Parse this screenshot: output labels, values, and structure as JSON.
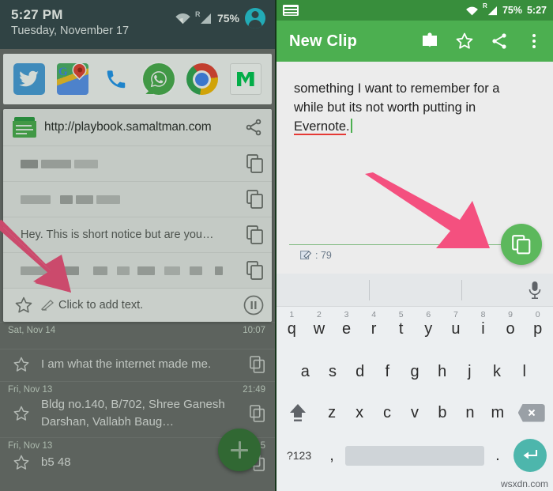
{
  "left": {
    "status_bar": {
      "time": "5:27 PM",
      "date": "Tuesday, November 17",
      "battery": "75%",
      "wifi_icon": "wifi-icon",
      "signal_icon": "roaming-signal-icon",
      "avatar_icon": "user-avatar-icon"
    },
    "shortcuts": [
      {
        "name": "twitter",
        "glyph": "🐦"
      },
      {
        "name": "google-maps",
        "glyph": ""
      },
      {
        "name": "phone",
        "glyph": "✆"
      },
      {
        "name": "whatsapp",
        "glyph": "✆"
      },
      {
        "name": "chrome",
        "glyph": ""
      },
      {
        "name": "medium",
        "glyph": ""
      }
    ],
    "notification": {
      "app_icon": "clipboard-notes-icon",
      "url": "http://playbook.samaltman.com",
      "share_icon": "share-icon",
      "clips": [
        {
          "text": "",
          "redacted": true,
          "redact_widths": [
            22,
            38,
            30
          ]
        },
        {
          "text": "",
          "redacted": true,
          "redact_widths": [
            38,
            16,
            22,
            30,
            18
          ]
        },
        {
          "text": "Hey. This is short notice but are you…",
          "redacted": false
        },
        {
          "text": "",
          "redacted": true,
          "redact_widths": [
            40,
            30,
            18,
            16,
            22,
            20,
            16,
            14,
            10
          ]
        }
      ],
      "footer": {
        "star_icon": "star-outline-icon",
        "edit_icon": "edit-pencil-icon",
        "hint": "Click to add text.",
        "pause_icon": "pause-circle-icon"
      }
    },
    "background_list": [
      {
        "date": "Sat, Nov 14",
        "time": "10:07",
        "text": "",
        "clipped": true
      },
      {
        "date": "",
        "time": "",
        "text": "I am what the internet made me."
      },
      {
        "date": "Fri, Nov 13",
        "time": "21:49",
        "text": "Bldg no.140, B/702, Shree Ganesh Darshan, Vallabh Baug…"
      },
      {
        "date": "Fri, Nov 13",
        "time": "15",
        "text": "b5 48"
      }
    ],
    "fab": {
      "icon": "plus-icon",
      "label": "+"
    }
  },
  "right": {
    "status_bar": {
      "keyboard_icon": "keyboard-icon",
      "wifi_icon": "wifi-icon",
      "signal_icon": "roaming-signal-icon",
      "battery": "75%",
      "time": "5:27"
    },
    "appbar": {
      "title": "New Clip",
      "actions": [
        {
          "name": "book-icon"
        },
        {
          "name": "star-outline-icon"
        },
        {
          "name": "share-icon"
        },
        {
          "name": "overflow-menu-icon"
        }
      ]
    },
    "editor": {
      "line1": "something I want to remember for a",
      "line2": "while but its not worth putting in",
      "misspelled_word": "Evernote",
      "trailing": ".",
      "char_count_icon": "character-count-icon",
      "char_count": ": 79"
    },
    "fab": {
      "icon": "copy-icon"
    },
    "keyboard": {
      "suggestion_bar": {
        "mic_icon": "microphone-icon",
        "suggestions": [
          "",
          "",
          ""
        ]
      },
      "row1": [
        {
          "key": "q",
          "num": "1"
        },
        {
          "key": "w",
          "num": "2"
        },
        {
          "key": "e",
          "num": "3"
        },
        {
          "key": "r",
          "num": "4"
        },
        {
          "key": "t",
          "num": "5"
        },
        {
          "key": "y",
          "num": "6"
        },
        {
          "key": "u",
          "num": "7"
        },
        {
          "key": "i",
          "num": "8"
        },
        {
          "key": "o",
          "num": "9"
        },
        {
          "key": "p",
          "num": "0"
        }
      ],
      "row2": [
        "a",
        "s",
        "d",
        "f",
        "g",
        "h",
        "j",
        "k",
        "l"
      ],
      "row3": {
        "shift_icon": "shift-icon",
        "keys": [
          "z",
          "x",
          "c",
          "v",
          "b",
          "n",
          "m"
        ],
        "backspace_icon": "backspace-icon"
      },
      "row4": {
        "symbols": "?123",
        "comma": ",",
        "space": "",
        "period": ".",
        "enter_icon": "enter-icon"
      }
    }
  },
  "watermark": "wsxdn.com",
  "colors": {
    "appbar_green": "#4caf50",
    "status_green": "#388e3c",
    "fab_green": "#5cb85c",
    "arrow_pink": "#f4507f",
    "status_dark": "#37474f",
    "enter_teal": "#4db6ac",
    "spell_red": "#e53935"
  }
}
